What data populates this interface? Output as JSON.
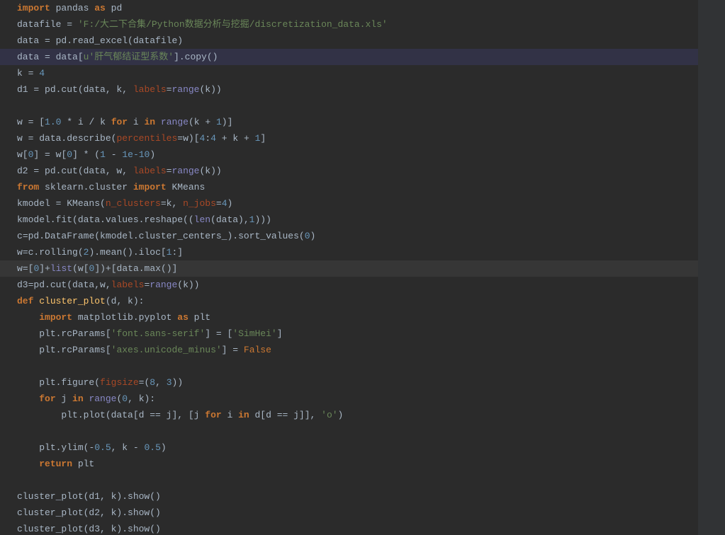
{
  "code": {
    "lines": [
      {
        "cls": "",
        "tokens": [
          {
            "c": "kw",
            "t": "import"
          },
          {
            "t": " pandas "
          },
          {
            "c": "kw",
            "t": "as"
          },
          {
            "t": " pd"
          }
        ]
      },
      {
        "cls": "",
        "tokens": [
          {
            "t": "datafile "
          },
          {
            "c": "op",
            "t": "="
          },
          {
            "t": " "
          },
          {
            "c": "str",
            "t": "'F:/大二下合集/Python数据分析与挖掘/discretization_data.xls'"
          }
        ]
      },
      {
        "cls": "",
        "tokens": [
          {
            "t": "data "
          },
          {
            "c": "op",
            "t": "="
          },
          {
            "t": " pd.read_excel(datafile)"
          }
        ]
      },
      {
        "cls": "highlight",
        "tokens": [
          {
            "t": "data "
          },
          {
            "c": "op",
            "t": "="
          },
          {
            "t": " data["
          },
          {
            "c": "str",
            "t": "u'肝气郁结证型系数'"
          },
          {
            "t": "].copy()"
          }
        ]
      },
      {
        "cls": "",
        "tokens": [
          {
            "t": "k "
          },
          {
            "c": "op",
            "t": "="
          },
          {
            "t": " "
          },
          {
            "c": "num",
            "t": "4"
          }
        ]
      },
      {
        "cls": "",
        "tokens": [
          {
            "t": "d1 "
          },
          {
            "c": "op",
            "t": "="
          },
          {
            "t": " pd.cut(data, k, "
          },
          {
            "c": "param",
            "t": "labels"
          },
          {
            "c": "op",
            "t": "="
          },
          {
            "c": "builtin",
            "t": "range"
          },
          {
            "t": "(k))"
          }
        ]
      },
      {
        "cls": "",
        "tokens": [
          {
            "t": ""
          }
        ]
      },
      {
        "cls": "",
        "tokens": [
          {
            "t": "w "
          },
          {
            "c": "op",
            "t": "="
          },
          {
            "t": " ["
          },
          {
            "c": "num",
            "t": "1.0"
          },
          {
            "t": " "
          },
          {
            "c": "op",
            "t": "*"
          },
          {
            "t": " i "
          },
          {
            "c": "op",
            "t": "/"
          },
          {
            "t": " k "
          },
          {
            "c": "kw",
            "t": "for"
          },
          {
            "t": " i "
          },
          {
            "c": "kw",
            "t": "in"
          },
          {
            "t": " "
          },
          {
            "c": "builtin",
            "t": "range"
          },
          {
            "t": "(k "
          },
          {
            "c": "op",
            "t": "+"
          },
          {
            "t": " "
          },
          {
            "c": "num",
            "t": "1"
          },
          {
            "t": ")]"
          }
        ]
      },
      {
        "cls": "",
        "tokens": [
          {
            "t": "w "
          },
          {
            "c": "op",
            "t": "="
          },
          {
            "t": " data.describe("
          },
          {
            "c": "param",
            "t": "percentiles"
          },
          {
            "c": "op",
            "t": "="
          },
          {
            "t": "w)["
          },
          {
            "c": "num",
            "t": "4"
          },
          {
            "t": ":"
          },
          {
            "c": "num",
            "t": "4"
          },
          {
            "t": " "
          },
          {
            "c": "op",
            "t": "+"
          },
          {
            "t": " k "
          },
          {
            "c": "op",
            "t": "+"
          },
          {
            "t": " "
          },
          {
            "c": "num",
            "t": "1"
          },
          {
            "t": "]"
          }
        ]
      },
      {
        "cls": "",
        "tokens": [
          {
            "t": "w["
          },
          {
            "c": "num",
            "t": "0"
          },
          {
            "t": "] "
          },
          {
            "c": "op",
            "t": "="
          },
          {
            "t": " w["
          },
          {
            "c": "num",
            "t": "0"
          },
          {
            "t": "] "
          },
          {
            "c": "op",
            "t": "*"
          },
          {
            "t": " ("
          },
          {
            "c": "num",
            "t": "1"
          },
          {
            "t": " "
          },
          {
            "c": "op",
            "t": "-"
          },
          {
            "t": " "
          },
          {
            "c": "num",
            "t": "1e-10"
          },
          {
            "t": ")"
          }
        ]
      },
      {
        "cls": "",
        "tokens": [
          {
            "t": "d2 "
          },
          {
            "c": "op",
            "t": "="
          },
          {
            "t": " pd.cut(data, w, "
          },
          {
            "c": "param",
            "t": "labels"
          },
          {
            "c": "op",
            "t": "="
          },
          {
            "c": "builtin",
            "t": "range"
          },
          {
            "t": "(k))"
          }
        ]
      },
      {
        "cls": "",
        "tokens": [
          {
            "c": "kw",
            "t": "from"
          },
          {
            "t": " sklearn.cluster "
          },
          {
            "c": "kw",
            "t": "import"
          },
          {
            "t": " KMeans"
          }
        ]
      },
      {
        "cls": "",
        "tokens": [
          {
            "t": "kmodel "
          },
          {
            "c": "op",
            "t": "="
          },
          {
            "t": " KMeans("
          },
          {
            "c": "param",
            "t": "n_clusters"
          },
          {
            "c": "op",
            "t": "="
          },
          {
            "t": "k, "
          },
          {
            "c": "param",
            "t": "n_jobs"
          },
          {
            "c": "op",
            "t": "="
          },
          {
            "c": "num",
            "t": "4"
          },
          {
            "t": ")"
          }
        ]
      },
      {
        "cls": "",
        "tokens": [
          {
            "t": "kmodel.fit(data.values.reshape(("
          },
          {
            "c": "builtin",
            "t": "len"
          },
          {
            "t": "(data),"
          },
          {
            "c": "num",
            "t": "1"
          },
          {
            "t": ")))"
          }
        ]
      },
      {
        "cls": "",
        "tokens": [
          {
            "t": "c"
          },
          {
            "c": "op",
            "t": "="
          },
          {
            "t": "pd.DataFrame(kmodel.cluster_centers_).sort_values("
          },
          {
            "c": "num",
            "t": "0"
          },
          {
            "t": ")"
          }
        ]
      },
      {
        "cls": "",
        "tokens": [
          {
            "t": "w"
          },
          {
            "c": "op",
            "t": "="
          },
          {
            "t": "c.rolling("
          },
          {
            "c": "num",
            "t": "2"
          },
          {
            "t": ").mean().iloc["
          },
          {
            "c": "num",
            "t": "1"
          },
          {
            "t": ":]"
          }
        ]
      },
      {
        "cls": "highlight-dark",
        "tokens": [
          {
            "t": "w"
          },
          {
            "c": "op",
            "t": "="
          },
          {
            "t": "["
          },
          {
            "c": "num",
            "t": "0"
          },
          {
            "t": "]"
          },
          {
            "c": "op",
            "t": "+"
          },
          {
            "c": "builtin",
            "t": "list"
          },
          {
            "t": "(w["
          },
          {
            "c": "num",
            "t": "0"
          },
          {
            "t": "])"
          },
          {
            "c": "op",
            "t": "+"
          },
          {
            "t": "[data.max()]"
          }
        ]
      },
      {
        "cls": "",
        "tokens": [
          {
            "t": "d3"
          },
          {
            "c": "op",
            "t": "="
          },
          {
            "t": "pd.cut(data,w,"
          },
          {
            "c": "param",
            "t": "labels"
          },
          {
            "c": "op",
            "t": "="
          },
          {
            "c": "builtin",
            "t": "range"
          },
          {
            "t": "(k))"
          }
        ]
      },
      {
        "cls": "",
        "tokens": [
          {
            "c": "kw",
            "t": "def"
          },
          {
            "t": " "
          },
          {
            "c": "deffn",
            "t": "cluster_plot"
          },
          {
            "t": "(d, k):"
          }
        ]
      },
      {
        "cls": "",
        "indent": 1,
        "tokens": [
          {
            "c": "kw",
            "t": "import"
          },
          {
            "t": " matplotlib.pyplot "
          },
          {
            "c": "kw",
            "t": "as"
          },
          {
            "t": " plt"
          }
        ]
      },
      {
        "cls": "",
        "indent": 1,
        "tokens": [
          {
            "t": "plt.rcParams["
          },
          {
            "c": "str",
            "t": "'font.sans-serif'"
          },
          {
            "t": "] "
          },
          {
            "c": "op",
            "t": "="
          },
          {
            "t": " ["
          },
          {
            "c": "str",
            "t": "'SimHei'"
          },
          {
            "t": "]"
          }
        ]
      },
      {
        "cls": "",
        "indent": 1,
        "tokens": [
          {
            "t": "plt.rcParams["
          },
          {
            "c": "str",
            "t": "'axes.unicode_minus'"
          },
          {
            "t": "] "
          },
          {
            "c": "op",
            "t": "="
          },
          {
            "t": " "
          },
          {
            "c": "boolf",
            "t": "False"
          }
        ]
      },
      {
        "cls": "",
        "tokens": [
          {
            "t": ""
          }
        ]
      },
      {
        "cls": "",
        "indent": 1,
        "tokens": [
          {
            "t": "plt.figure("
          },
          {
            "c": "param",
            "t": "figsize"
          },
          {
            "c": "op",
            "t": "="
          },
          {
            "t": "("
          },
          {
            "c": "num",
            "t": "8"
          },
          {
            "t": ", "
          },
          {
            "c": "num",
            "t": "3"
          },
          {
            "t": "))"
          }
        ]
      },
      {
        "cls": "",
        "indent": 1,
        "tokens": [
          {
            "c": "kw",
            "t": "for"
          },
          {
            "t": " j "
          },
          {
            "c": "kw",
            "t": "in"
          },
          {
            "t": " "
          },
          {
            "c": "builtin",
            "t": "range"
          },
          {
            "t": "("
          },
          {
            "c": "num",
            "t": "0"
          },
          {
            "t": ", k):"
          }
        ]
      },
      {
        "cls": "",
        "indent": 2,
        "tokens": [
          {
            "t": "plt.plot(data[d "
          },
          {
            "c": "op",
            "t": "=="
          },
          {
            "t": " j], [j "
          },
          {
            "c": "kw",
            "t": "for"
          },
          {
            "t": " i "
          },
          {
            "c": "kw",
            "t": "in"
          },
          {
            "t": " d[d "
          },
          {
            "c": "op",
            "t": "=="
          },
          {
            "t": " j]], "
          },
          {
            "c": "str",
            "t": "'o'"
          },
          {
            "t": ")"
          }
        ]
      },
      {
        "cls": "",
        "tokens": [
          {
            "t": ""
          }
        ]
      },
      {
        "cls": "",
        "indent": 1,
        "tokens": [
          {
            "t": "plt.ylim("
          },
          {
            "c": "op",
            "t": "-"
          },
          {
            "c": "num",
            "t": "0.5"
          },
          {
            "t": ", k "
          },
          {
            "c": "op",
            "t": "-"
          },
          {
            "t": " "
          },
          {
            "c": "num",
            "t": "0.5"
          },
          {
            "t": ")"
          }
        ]
      },
      {
        "cls": "",
        "indent": 1,
        "tokens": [
          {
            "c": "kw",
            "t": "return"
          },
          {
            "t": " plt"
          }
        ]
      },
      {
        "cls": "",
        "tokens": [
          {
            "t": ""
          }
        ]
      },
      {
        "cls": "",
        "tokens": [
          {
            "t": "cluster_plot(d1, k).show()"
          }
        ]
      },
      {
        "cls": "",
        "tokens": [
          {
            "t": "cluster_plot(d2, k).show()"
          }
        ]
      },
      {
        "cls": "",
        "tokens": [
          {
            "t": "cluster_plot(d3, k).show()"
          }
        ]
      }
    ]
  }
}
